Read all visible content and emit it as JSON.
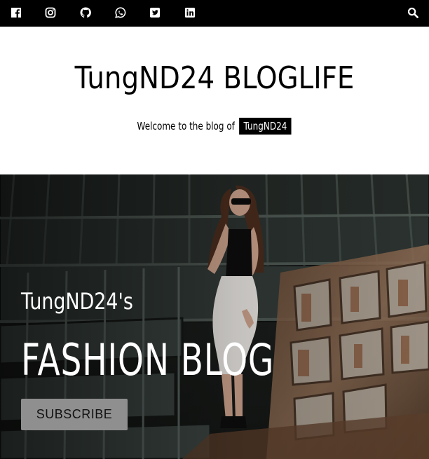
{
  "topbar": {
    "social_icons": [
      "facebook-icon",
      "instagram-icon",
      "github-icon",
      "whatsapp-icon",
      "twitter-icon",
      "linkedin-icon"
    ],
    "search_icon": "search-icon"
  },
  "header": {
    "title": "TungND24 BLOGLIFE",
    "tagline_prefix": "Welcome to the blog of",
    "tagline_badge": "TungND24"
  },
  "hero": {
    "subtitle": "TungND24's",
    "title": "FASHION BLOG",
    "button_label": "SUBSCRIBE"
  },
  "colors": {
    "topbar_bg": "#000000",
    "header_bg": "#ffffff",
    "badge_bg": "#000000",
    "button_bg": "#8f8f8f"
  }
}
